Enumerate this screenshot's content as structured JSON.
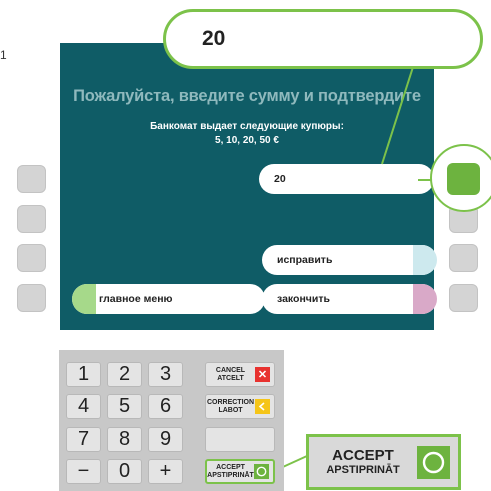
{
  "step_number": "1",
  "screen": {
    "title": "Пожалуйста, введите сумму и подтвердите",
    "subtitle_line1": "Банкомат выдает следующие купюры:",
    "subtitle_line2": "5, 10, 20, 50 €",
    "amount_value": "20",
    "buttons": {
      "correct_label": "исправить",
      "main_menu_label": "главное меню",
      "finish_label": "закончить"
    }
  },
  "zoom": {
    "amount_value": "20",
    "accept_label": "ACCEPT",
    "accept_sub": "APSTIPRINĀT"
  },
  "keypad": {
    "digits": [
      "1",
      "2",
      "3",
      "4",
      "5",
      "6",
      "7",
      "8",
      "9",
      "−",
      "0",
      "+"
    ],
    "cancel_label": "CANCEL",
    "cancel_sub": "ATCELT",
    "correction_label": "CORRECTION",
    "correction_sub": "LABOT",
    "accept_label": "ACCEPT",
    "accept_sub": "APSTIPRINĀT"
  },
  "colors": {
    "screen_bg": "#0f5c66",
    "highlight_green": "#7cc24a",
    "accept_green": "#6db33f",
    "cancel_red": "#e8322f",
    "correction_yellow": "#f5c518",
    "correct_accent": "#cde9ee",
    "menu_accent": "#a6d98a",
    "finish_accent": "#d9a9c8"
  },
  "icons": {
    "cancel": "x-icon",
    "correction": "chevron-left-icon",
    "accept": "circle-icon"
  }
}
